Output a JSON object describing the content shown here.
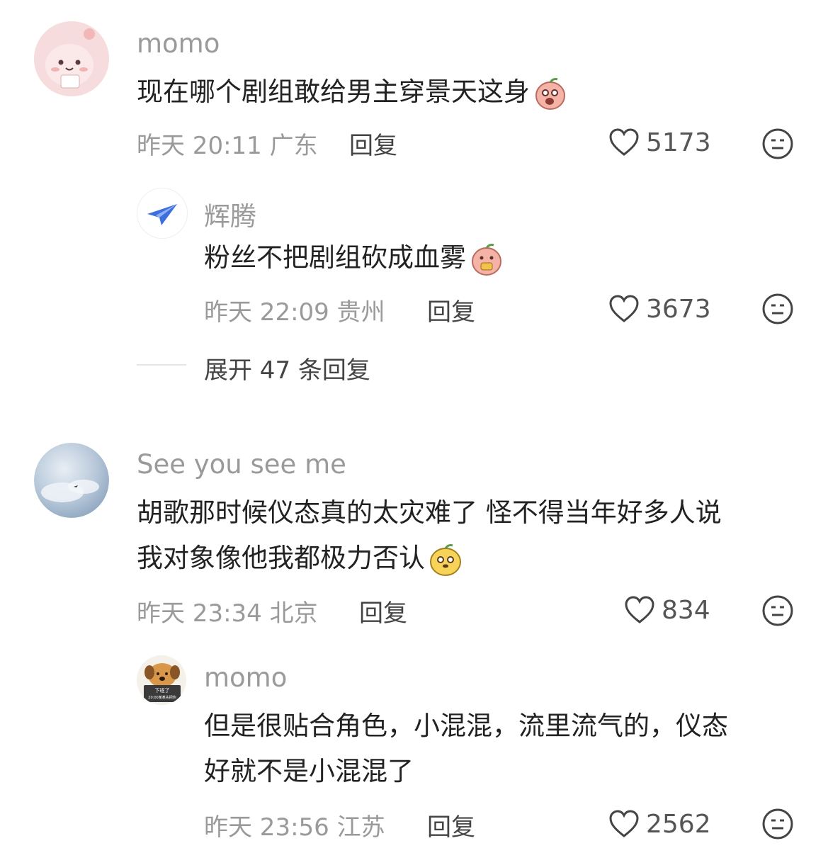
{
  "comments": [
    {
      "user": "momo",
      "text_lines": [
        "现在哪个剧组敢给男主穿景天这身"
      ],
      "time": "昨天 20:11 广东",
      "reply_label": "回复",
      "likes": "5173",
      "replies": [
        {
          "user": "辉腾",
          "text_lines": [
            "粉丝不把剧组砍成血雾"
          ],
          "time": "昨天 22:09 贵州",
          "reply_label": "回复",
          "likes": "3673"
        }
      ],
      "expand_label": "展开 47 条回复"
    },
    {
      "user": "See you see me",
      "text_lines": [
        "胡歌那时候仪态真的太灾难了 怪不得当年好多人说",
        "我对象像他我都极力否认"
      ],
      "time": "昨天 23:34 北京",
      "reply_label": "回复",
      "likes": "834",
      "replies": [
        {
          "user": "momo",
          "avatar_text": [
            "下班了",
            "20:00某某先把你"
          ],
          "text_lines": [
            "但是很贴合角色，小混混，流里流气的，仪态",
            "好就不是小混混了"
          ],
          "time": "昨天 23:56 江苏",
          "reply_label": "回复",
          "likes": "2562"
        }
      ]
    }
  ]
}
